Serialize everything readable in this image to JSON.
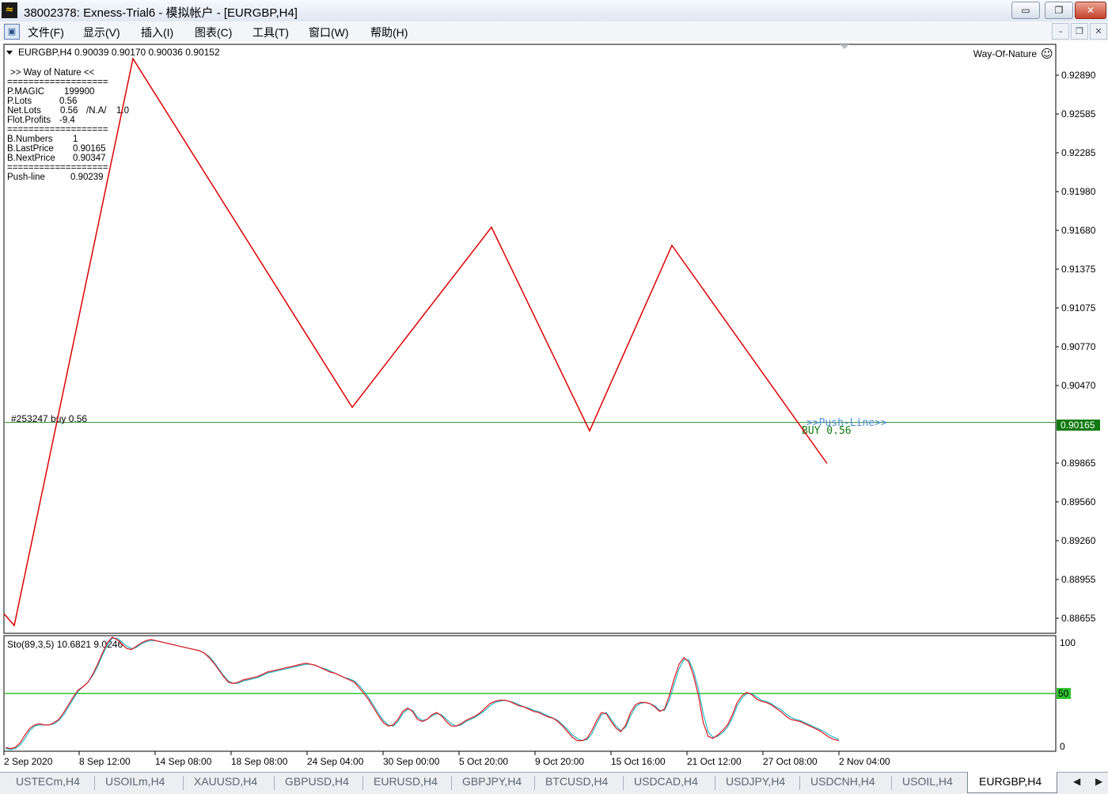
{
  "window": {
    "icon_glyph": "≈",
    "title": "38002378: Exness-Trial6 - 模拟帐户 - [EURGBP,H4]",
    "minimize_glyph": "▭",
    "restore_glyph": "❐",
    "close_glyph": "✕",
    "mdi_minimize_glyph": "–",
    "mdi_restore_glyph": "❐",
    "mdi_close_glyph": "✕"
  },
  "menu": {
    "mdi_icon": "chart-window-icon",
    "mdi_icon_glyph": "▣",
    "items": [
      "文件(F)",
      "显示(V)",
      "插入(I)",
      "图表(C)",
      "工具(T)",
      "窗口(W)",
      "帮助(H)"
    ]
  },
  "chart": {
    "header": "EURGBP,H4  0.90039 0.90170 0.90036 0.90152",
    "ea_name": "Way-Of-Nature",
    "ea_smiley": "☺",
    "info_panel": {
      "title": ">> Way of Nature <<",
      "separator": "===================",
      "magic_label": "P.MAGIC",
      "magic_value": "199900",
      "lots_label": "P.Lots",
      "lots_value": "0.56",
      "netlots_label": "Net.Lots",
      "netlots_value": "0.56",
      "netlots_mid": "/N.A/",
      "netlots_right": "1.0",
      "flot_label": "Flot.Profits",
      "flot_value": "-9.4",
      "bnumbers_label": "B.Numbers",
      "bnumbers_value": "1",
      "blast_label": "B.LastPrice",
      "blast_value": "0.90165",
      "bnext_label": "B.NextPrice",
      "bnext_value": "0.90347",
      "push_label": "Push-line",
      "push_value": "0.90239"
    },
    "order_label": "#253247 buy 0.56",
    "push_line_text": ">>Push-Line>>",
    "buy_text": "BUY  0.56",
    "price_axis": [
      "0.92890",
      "0.92585",
      "0.92285",
      "0.91980",
      "0.91680",
      "0.91375",
      "0.91075",
      "0.90770",
      "0.90470",
      "0.89865",
      "0.89560",
      "0.89260",
      "0.88955",
      "0.88655"
    ],
    "current_price": "0.90165",
    "colors": {
      "zigzag": "#dd0000",
      "order_line": "#2e8b2e",
      "price_badge": "#117a11",
      "push_text": "#4a90d9",
      "stoch_main": "#e4141b",
      "stoch_signal": "#1fb9c7",
      "level_50": "#2ec42e"
    }
  },
  "chart_data": {
    "type": "line",
    "title": "EURGBP,H4",
    "x_labels": [
      "2 Sep 2020",
      "8 Sep 12:00",
      "14 Sep 08:00",
      "18 Sep 08:00",
      "24 Sep 04:00",
      "30 Sep 00:00",
      "5 Oct 20:00",
      "9 Oct 20:00",
      "15 Oct 16:00",
      "21 Oct 12:00",
      "27 Oct 08:00",
      "2 Nov 04:00"
    ],
    "ylim": [
      0.8855,
      0.9306
    ],
    "series": [
      {
        "points": [
          {
            "x": "2 Sep 2020",
            "y": 0.887
          },
          {
            "x": "2 Sep 2020",
            "y": 0.8861
          },
          {
            "x": "10 Sep 2020",
            "y": 0.9295
          },
          {
            "x": "25 Sep 2020",
            "y": 0.9028
          },
          {
            "x": "6 Oct 2020",
            "y": 0.9166
          },
          {
            "x": "12 Oct 2020",
            "y": 0.901
          },
          {
            "x": "19 Oct 2020",
            "y": 0.9152
          },
          {
            "x": "2 Nov 2020",
            "y": 0.8985
          }
        ]
      }
    ],
    "order_line_price": 0.90165,
    "indicator": {
      "label": "Sto(89,3,5) 10.6821 9.0246",
      "ylim": [
        0,
        100
      ],
      "axis_labels": [
        "100",
        "50",
        "0"
      ],
      "level": 50,
      "main": [
        2,
        1,
        2,
        6,
        13,
        19,
        22,
        23,
        22,
        22,
        24,
        27,
        33,
        40,
        47,
        53,
        56,
        60,
        67,
        76,
        86,
        95,
        100,
        98,
        94,
        90,
        89,
        92,
        95,
        97,
        98,
        97,
        96,
        95,
        94,
        93,
        92,
        91,
        90,
        89,
        88,
        86,
        82,
        77,
        71,
        65,
        60,
        59,
        60,
        62,
        63,
        64,
        65,
        67,
        69,
        70,
        71,
        72,
        73,
        74,
        75,
        76,
        77,
        76,
        75,
        73,
        71,
        69,
        68,
        66,
        64,
        62,
        60,
        55,
        50,
        44,
        37,
        30,
        24,
        21,
        22,
        27,
        34,
        37,
        34,
        27,
        25,
        27,
        31,
        33,
        30,
        25,
        21,
        21,
        23,
        26,
        28,
        30,
        33,
        37,
        41,
        43,
        44,
        44,
        43,
        41,
        39,
        38,
        36,
        34,
        33,
        31,
        29,
        28,
        25,
        21,
        16,
        11,
        8,
        8,
        10,
        17,
        26,
        33,
        32,
        25,
        19,
        16,
        22,
        33,
        40,
        42,
        42,
        41,
        38,
        34,
        36,
        48,
        63,
        76,
        82,
        78,
        66,
        48,
        24,
        12,
        10,
        13,
        17,
        22,
        31,
        42,
        48,
        51,
        49,
        45,
        43,
        42,
        40,
        37,
        34,
        30,
        27,
        26,
        25,
        23,
        21,
        19,
        17,
        14,
        11,
        9,
        8
      ],
      "signal": [
        1,
        0,
        1,
        4,
        10,
        17,
        21,
        22,
        22,
        22,
        23,
        26,
        31,
        38,
        45,
        52,
        56,
        60,
        66,
        74,
        84,
        93,
        99,
        99,
        96,
        92,
        90,
        91,
        94,
        96,
        97,
        97,
        96,
        95,
        94,
        93,
        92,
        91,
        90,
        89,
        88,
        86,
        83,
        78,
        72,
        66,
        61,
        59,
        59,
        61,
        62,
        63,
        64,
        66,
        68,
        69,
        70,
        71,
        72,
        73,
        74,
        75,
        76,
        76,
        75,
        73,
        72,
        70,
        68,
        66,
        64,
        63,
        61,
        57,
        52,
        46,
        39,
        32,
        26,
        22,
        21,
        25,
        32,
        36,
        35,
        29,
        26,
        27,
        30,
        32,
        31,
        27,
        23,
        21,
        22,
        25,
        27,
        29,
        32,
        35,
        39,
        42,
        43,
        44,
        43,
        42,
        40,
        38,
        37,
        35,
        34,
        32,
        30,
        28,
        26,
        22,
        18,
        13,
        10,
        8,
        9,
        14,
        23,
        31,
        33,
        27,
        21,
        17,
        20,
        30,
        38,
        41,
        42,
        41,
        39,
        35,
        35,
        44,
        58,
        72,
        80,
        80,
        70,
        54,
        32,
        16,
        11,
        12,
        15,
        20,
        28,
        39,
        46,
        50,
        50,
        47,
        44,
        43,
        41,
        38,
        36,
        32,
        29,
        27,
        26,
        24,
        22,
        20,
        18,
        16,
        13,
        11,
        9
      ]
    }
  }
}
